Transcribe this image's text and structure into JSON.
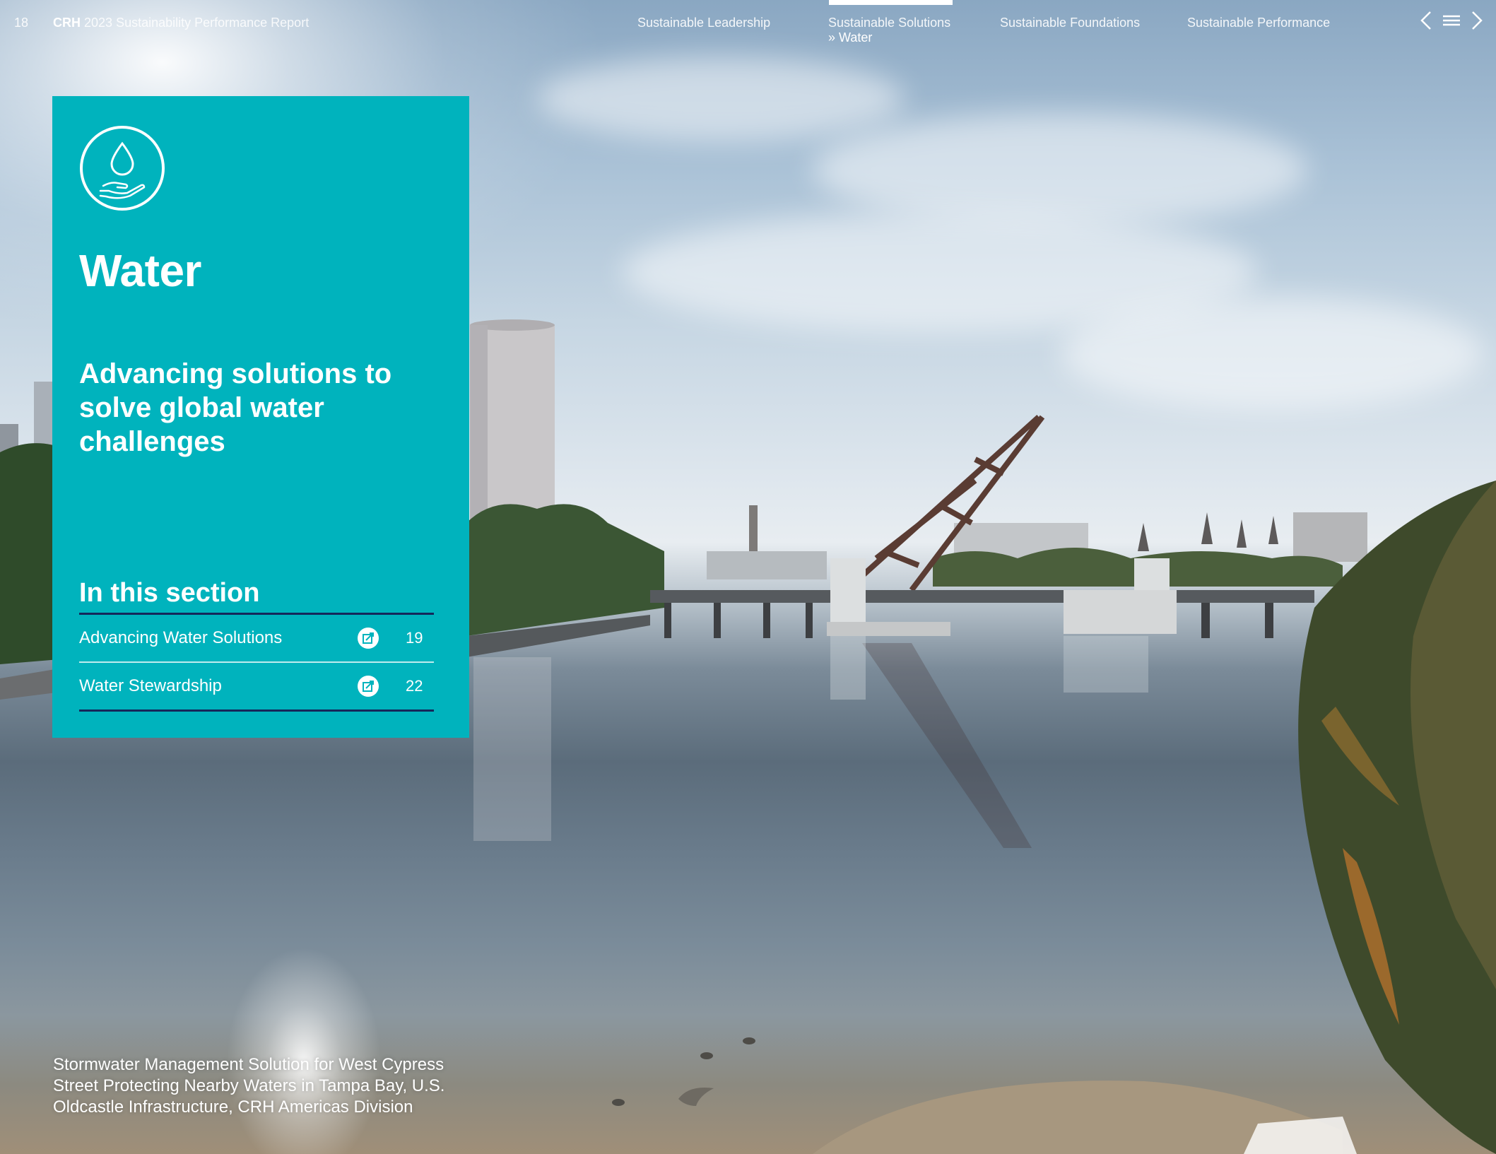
{
  "header": {
    "page_number": "18",
    "brand": "CRH",
    "report_title": "2023 Sustainability Performance Report",
    "nav": [
      {
        "label": "Sustainable Leadership",
        "active": false
      },
      {
        "label": "Sustainable Solutions",
        "active": true
      },
      {
        "label": "Sustainable Foundations",
        "active": false
      },
      {
        "label": "Sustainable Performance",
        "active": false
      }
    ],
    "active_subsection": "» Water",
    "icons": {
      "previous": "chevron-left-icon",
      "menu": "hamburger-menu-icon",
      "next": "chevron-right-icon"
    }
  },
  "panel": {
    "icon": "water-drop-hand-icon",
    "title": "Water",
    "subtitle": "Advancing solutions to solve global water challenges",
    "section_heading": "In this section",
    "items": [
      {
        "label": "Advancing Water Solutions",
        "page": "19",
        "icon": "external-link-icon"
      },
      {
        "label": "Water Stewardship",
        "page": "22",
        "icon": "external-link-icon"
      }
    ],
    "colors": {
      "background": "#00b3bd",
      "rule": "#15275a",
      "text": "#ffffff"
    }
  },
  "caption": {
    "lines": [
      "Stormwater Management Solution for West Cypress",
      "Street Protecting Nearby Waters in Tampa Bay, U.S.",
      "Oldcastle Infrastructure, CRH Americas Division"
    ]
  }
}
